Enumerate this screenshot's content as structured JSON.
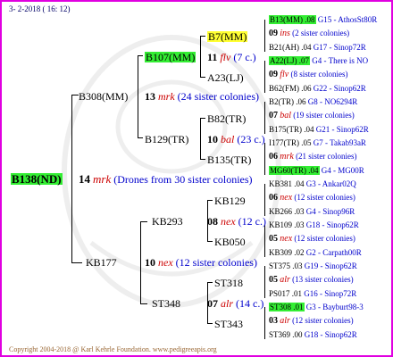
{
  "header": {
    "date": "3-  2-2018 ( 16: 12)"
  },
  "footer": {
    "copyright": "Copyright 2004-2018 @ Karl Kehrle Foundation.   www.pedigreeapis.org"
  },
  "root": {
    "code": "B138(ND)",
    "num": "14",
    "mark": "mrk",
    "note": "(Drones from 30 sister colonies)"
  },
  "gen1": [
    {
      "code": "B308(MM)",
      "num": "13",
      "mark": "mrk",
      "note": "(24 sister colonies)"
    },
    {
      "code": "KB177",
      "num": "10",
      "mark": "nex",
      "note": "(12 sister colonies)"
    }
  ],
  "gen2": [
    {
      "code": "B107(MM)",
      "num": "11",
      "mark": "flv",
      "note": "(7 c.)"
    },
    {
      "code": "B129(TR)",
      "num": "10",
      "mark": "bal",
      "note": "(23 c.)"
    },
    {
      "code": "KB293",
      "num": "08",
      "mark": "nex",
      "note": "(12 c.)"
    },
    {
      "code": "ST348",
      "num": "07",
      "mark": "alr",
      "note": "(14 c.)"
    }
  ],
  "gen3": [
    {
      "code": "B7(MM)"
    },
    {
      "code": "A23(LJ)"
    },
    {
      "code": "B82(TR)"
    },
    {
      "code": "B135(TR)"
    },
    {
      "code": "KB129"
    },
    {
      "code": "KB050"
    },
    {
      "code": "ST318"
    },
    {
      "code": "ST343"
    }
  ],
  "gen4": [
    {
      "code": "B13(MM) .08",
      "info": "G15 - AthosSt80R",
      "highlight": true
    },
    {
      "num": "09",
      "mark": "ins",
      "note": "(2 sister colonies)"
    },
    {
      "code": "B21(AH) .04",
      "info": "G17 - Sinop72R"
    },
    {
      "code": "A22(LJ) .07",
      "info": "G4 - There is NO",
      "highlight": true
    },
    {
      "num": "09",
      "mark": "flv",
      "note": "(8 sister colonies)"
    },
    {
      "code": "B62(FM) .06",
      "info": "G22 - Sinop62R"
    },
    {
      "code": "B2(TR) .06",
      "info": "G8 - NO6294R"
    },
    {
      "num": "07",
      "mark": "bal",
      "note": "(19 sister colonies)"
    },
    {
      "code": "B175(TR) .04",
      "info": "G21 - Sinop62R"
    },
    {
      "code": "I177(TR) .05",
      "info": "G7 - Takab93aR"
    },
    {
      "num": "06",
      "mark": "mrk",
      "note": "(21 sister colonies)"
    },
    {
      "code": "MG60(TR) .04",
      "info": "G4 - MG00R",
      "highlight": true
    },
    {
      "code": "KB381 .04",
      "info": "G3 - Ankar02Q"
    },
    {
      "num": "06",
      "mark": "nex",
      "note": "(12 sister colonies)"
    },
    {
      "code": "KB266 .03",
      "info": "G4 - Sinop96R"
    },
    {
      "code": "KB109 .03",
      "info": "G18 - Sinop62R"
    },
    {
      "num": "05",
      "mark": "nex",
      "note": "(12 sister colonies)"
    },
    {
      "code": "KB309 .02",
      "info": "G2 - Carpath00R"
    },
    {
      "code": "ST375 .03",
      "info": "G19 - Sinop62R"
    },
    {
      "num": "05",
      "mark": "alr",
      "note": "(13 sister colonies)"
    },
    {
      "code": "PS017 .01",
      "info": "G16 - Sinop72R"
    },
    {
      "code": "ST308 .01",
      "info": "G3 - Bayburt98-3",
      "highlight": true
    },
    {
      "num": "03",
      "mark": "alr",
      "note": "(12 sister colonies)"
    },
    {
      "code": "ST369 .00",
      "info": "G18 - Sinop62R"
    }
  ],
  "colors": {
    "frame": "#e000e0",
    "highlight": "#33ee33",
    "highlight_yellow": "#ffff33",
    "mark": "#cc0000",
    "info": "#0000cc"
  }
}
